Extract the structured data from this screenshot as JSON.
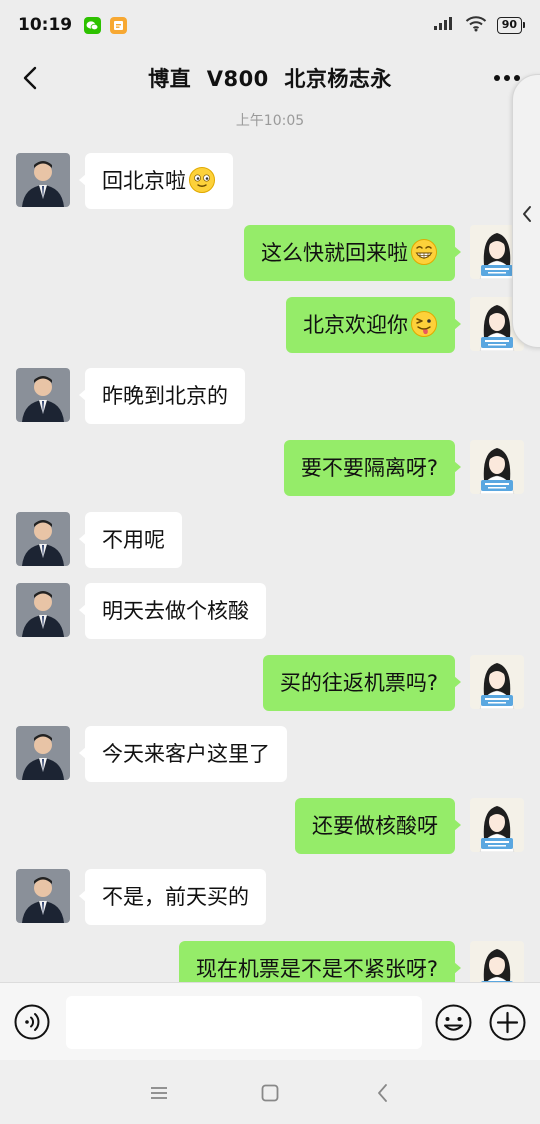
{
  "status_bar": {
    "time": "10:19",
    "battery": "90",
    "icons": [
      "wechat-app-icon",
      "notes-app-icon",
      "signal-icon",
      "wifi-icon",
      "battery-icon"
    ]
  },
  "header": {
    "title": "博直  V800  北京杨志永",
    "back_icon": "chevron-left-icon",
    "more_icon": "more-dots-icon"
  },
  "chat": {
    "timestamp": "上午10:05",
    "messages": [
      {
        "side": "left",
        "text": "回北京啦",
        "emoji": "smile"
      },
      {
        "side": "right",
        "text": "这么快就回来啦",
        "emoji": "grin"
      },
      {
        "side": "right",
        "text": "北京欢迎你",
        "emoji": "wink"
      },
      {
        "side": "left",
        "text": "昨晚到北京的"
      },
      {
        "side": "right",
        "text": "要不要隔离呀?"
      },
      {
        "side": "left",
        "text": "不用呢"
      },
      {
        "side": "left",
        "text": "明天去做个核酸"
      },
      {
        "side": "right",
        "text": "买的往返机票吗?"
      },
      {
        "side": "left",
        "text": "今天来客户这里了"
      },
      {
        "side": "right",
        "text": "还要做核酸呀"
      },
      {
        "side": "left",
        "text": "不是，前天买的"
      },
      {
        "side": "right",
        "text": "现在机票是不是不紧张呀?"
      }
    ]
  },
  "input_bar": {
    "placeholder": "",
    "voice_icon": "voice-icon",
    "emoji_icon": "emoji-icon",
    "plus_icon": "plus-icon"
  },
  "nav_bar": {
    "icons": [
      "menu-icon",
      "home-icon",
      "back-icon"
    ]
  },
  "colors": {
    "background": "#ededed",
    "sent_bubble": "#95ec69",
    "received_bubble": "#ffffff",
    "timestamp": "#9a9a9a"
  }
}
